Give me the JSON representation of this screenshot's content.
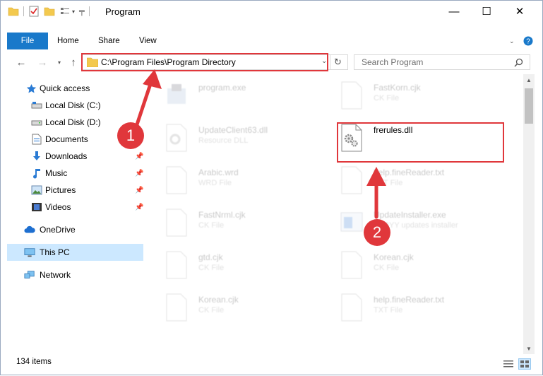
{
  "window": {
    "title": "Program",
    "minimize": "—",
    "maximize": "☐",
    "close": "✕"
  },
  "ribbon": {
    "tabs": [
      "File",
      "Home",
      "Share",
      "View"
    ],
    "expand_icon": "chevron-down-icon",
    "help_icon": "help-icon"
  },
  "navigation": {
    "back_icon": "arrow-left-icon",
    "forward_icon": "arrow-right-icon",
    "recent_icon": "chevron-down-icon",
    "up_icon": "arrow-up-icon",
    "address": "C:\\Program Files\\Program Directory",
    "search_placeholder": "Search Program"
  },
  "sidebar": {
    "items": [
      {
        "label": "Quick access",
        "icon": "star-icon"
      },
      {
        "label": "Local Disk (C:)",
        "icon": "drive-icon"
      },
      {
        "label": "Local Disk (D:)",
        "icon": "drive-icon"
      },
      {
        "label": "Documents",
        "icon": "documents-icon",
        "pinned": true
      },
      {
        "label": "Downloads",
        "icon": "download-icon",
        "pinned": true
      },
      {
        "label": "Music",
        "icon": "music-icon",
        "pinned": true
      },
      {
        "label": "Pictures",
        "icon": "pictures-icon",
        "pinned": true
      },
      {
        "label": "Videos",
        "icon": "videos-icon",
        "pinned": true
      },
      {
        "label": "OneDrive",
        "icon": "cloud-icon"
      },
      {
        "label": "This PC",
        "icon": "computer-icon",
        "selected": true
      },
      {
        "label": "Network",
        "icon": "network-icon"
      }
    ]
  },
  "files": [
    {
      "name": "program.exe",
      "type": "",
      "icon": "program-icon"
    },
    {
      "name": "FastKorn.cjk",
      "type": "CK File",
      "icon": "file-icon"
    },
    {
      "name": "UpdateClient63.dll",
      "type": "Resource DLL",
      "icon": "gear-file-icon"
    },
    {
      "name": "frerules.dll",
      "type": "",
      "icon": "gear-file-icon",
      "highlighted": true
    },
    {
      "name": "Arabic.wrd",
      "type": "WRD File",
      "icon": "file-icon"
    },
    {
      "name": "help.fineReader.txt",
      "type": "TXT File",
      "icon": "file-icon"
    },
    {
      "name": "FastNrml.cjk",
      "type": "CK File",
      "icon": "file-icon"
    },
    {
      "name": "UpdateInstaller.exe",
      "type": "ABBYY updates installer",
      "icon": "installer-icon"
    },
    {
      "name": "gtd.cjk",
      "type": "CK File",
      "icon": "file-icon"
    },
    {
      "name": "Korean.cjk",
      "type": "CK File",
      "icon": "file-icon"
    },
    {
      "name": "Korean.cjk",
      "type": "CK File",
      "icon": "file-icon"
    },
    {
      "name": "help.fineReader.txt",
      "type": "TXT File",
      "icon": "file-icon"
    }
  ],
  "status": {
    "item_count": "134 items"
  },
  "annotations": {
    "step1": "1",
    "step2": "2",
    "color": "#e0373b"
  }
}
